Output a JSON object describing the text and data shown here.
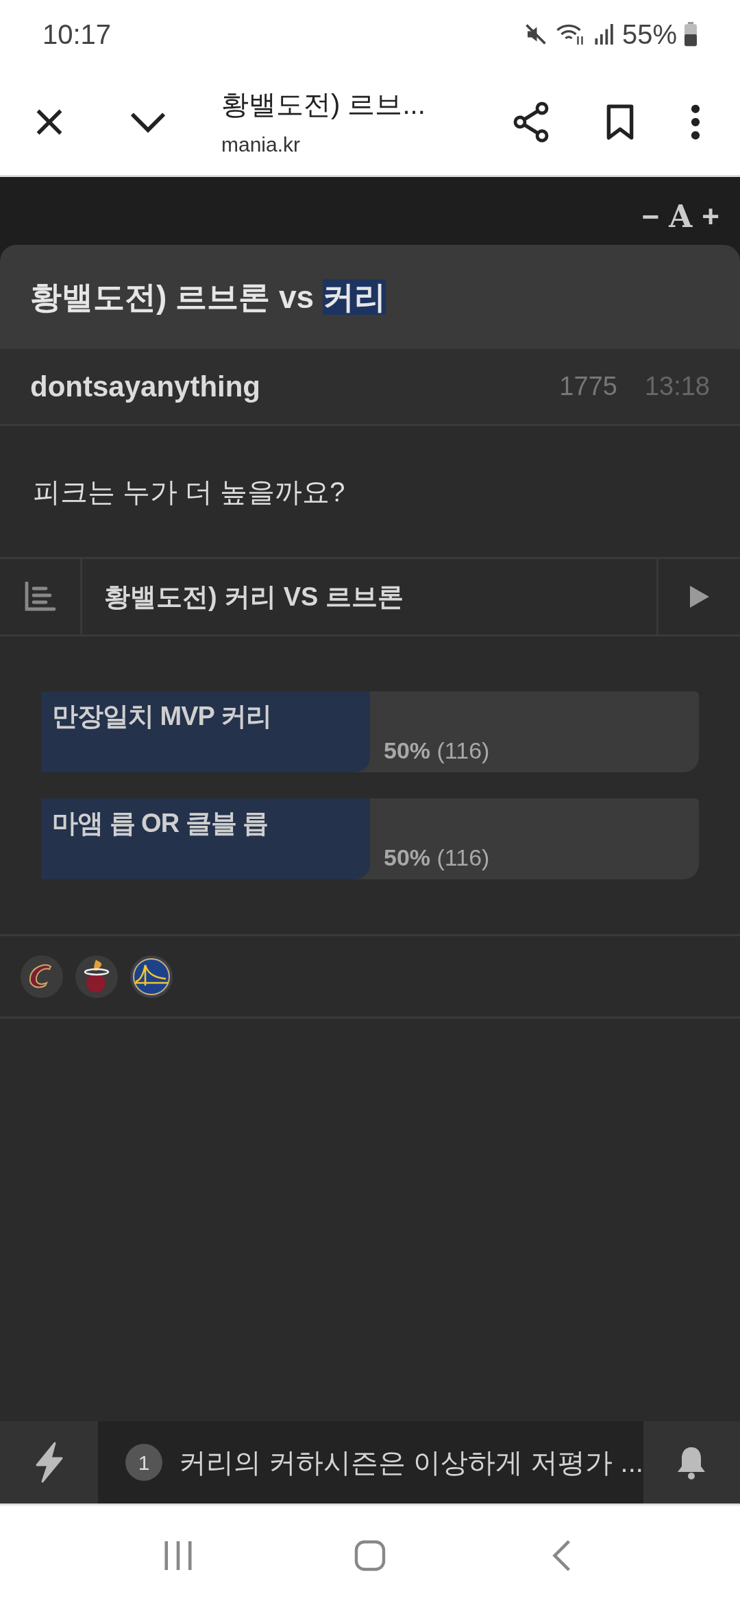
{
  "status_bar": {
    "time": "10:17",
    "battery": "55%"
  },
  "browser_bar": {
    "title": "황밸도전) 르브...",
    "url": "mania.kr"
  },
  "font_controls": {
    "decrease": "−",
    "font": "A",
    "increase": "+"
  },
  "post": {
    "title_parts": [
      {
        "text": "황밸도전) 르브론 vs ",
        "selected": false
      },
      {
        "text": "커리",
        "selected": true
      }
    ],
    "author": "dontsayanything",
    "views": "1775",
    "time": "13:18",
    "body": "피크는 누가 더 높을까요?"
  },
  "poll": {
    "title": "황밸도전) 커리 VS 르브론",
    "options": [
      {
        "label": "만장일치 MVP 커리",
        "result": "**50%** (116)",
        "level": 0.5
      },
      {
        "label": "마앰 릅 OR 클블 릅",
        "result": "**50%** (116)",
        "level": 0.5
      }
    ]
  },
  "tags": [
    {
      "kind": "crescent"
    },
    {
      "kind": "flame"
    },
    {
      "kind": "bridge"
    }
  ],
  "bottom_bar": {
    "badge": "1",
    "ticker": "커리의 커하시즌은 이상하게 저평가 ..."
  }
}
